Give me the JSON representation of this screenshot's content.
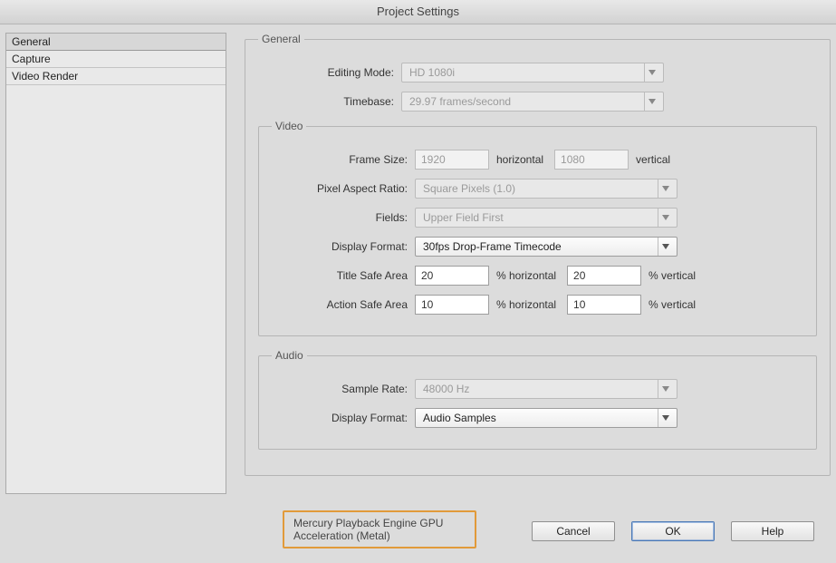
{
  "window": {
    "title": "Project Settings"
  },
  "sidebar": {
    "items": [
      {
        "label": "General",
        "selected": true
      },
      {
        "label": "Capture",
        "selected": false
      },
      {
        "label": "Video Render",
        "selected": false
      }
    ]
  },
  "groups": {
    "general": {
      "legend": "General",
      "editing_mode": {
        "label": "Editing Mode:",
        "value": "HD 1080i",
        "enabled": false
      },
      "timebase": {
        "label": "Timebase:",
        "value": "29.97 frames/second",
        "enabled": false
      }
    },
    "video": {
      "legend": "Video",
      "frame_size": {
        "label": "Frame Size:",
        "h_value": "1920",
        "h_unit": "horizontal",
        "v_value": "1080",
        "v_unit": "vertical",
        "enabled": false
      },
      "pixel_aspect": {
        "label": "Pixel Aspect Ratio:",
        "value": "Square Pixels (1.0)",
        "enabled": false
      },
      "fields": {
        "label": "Fields:",
        "value": "Upper Field First",
        "enabled": false
      },
      "display_format": {
        "label": "Display Format:",
        "value": "30fps Drop-Frame Timecode",
        "enabled": true
      },
      "title_safe": {
        "label": "Title Safe Area",
        "h_value": "20",
        "h_unit": "% horizontal",
        "v_value": "20",
        "v_unit": "% vertical"
      },
      "action_safe": {
        "label": "Action Safe Area",
        "h_value": "10",
        "h_unit": "% horizontal",
        "v_value": "10",
        "v_unit": "% vertical"
      }
    },
    "audio": {
      "legend": "Audio",
      "sample_rate": {
        "label": "Sample Rate:",
        "value": "48000 Hz",
        "enabled": false
      },
      "display_format": {
        "label": "Display Format:",
        "value": "Audio Samples",
        "enabled": true
      }
    }
  },
  "highlight": {
    "text": "Mercury Playback Engine GPU Acceleration (Metal)"
  },
  "buttons": {
    "cancel": "Cancel",
    "ok": "OK",
    "help": "Help"
  }
}
